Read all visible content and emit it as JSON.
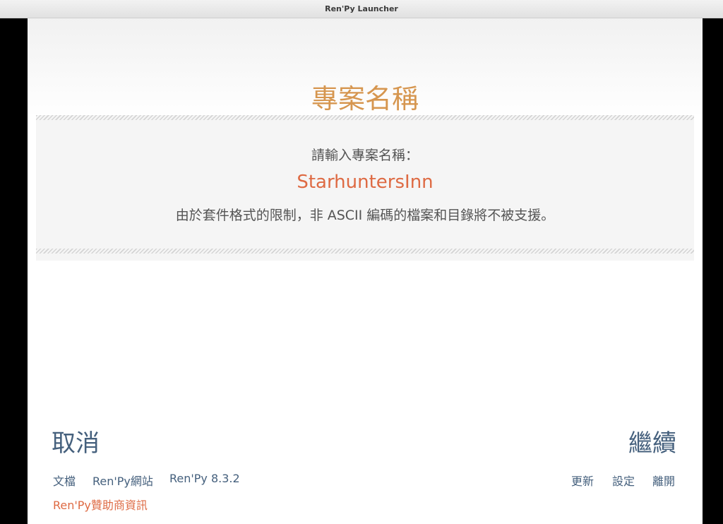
{
  "window": {
    "title": "Ren'Py Launcher"
  },
  "page": {
    "title": "專案名稱",
    "prompt": "請輸入專案名稱：",
    "project_name": "StarhuntersInn",
    "notice": "由於套件格式的限制，非 ASCII 編碼的檔案和目錄將不被支援。"
  },
  "navigation": {
    "cancel_label": "取消",
    "continue_label": "繼續"
  },
  "footer": {
    "left_links": [
      "文檔",
      "Ren'Py網站",
      "Ren'Py 8.3.2"
    ],
    "right_links": [
      "更新",
      "設定",
      "離開"
    ],
    "sponsor_link": "Ren'Py贊助商資訊"
  },
  "colors": {
    "title_accent": "#d6964f",
    "value_accent": "#de6a43",
    "link": "#45607d",
    "body_text": "#545454"
  }
}
